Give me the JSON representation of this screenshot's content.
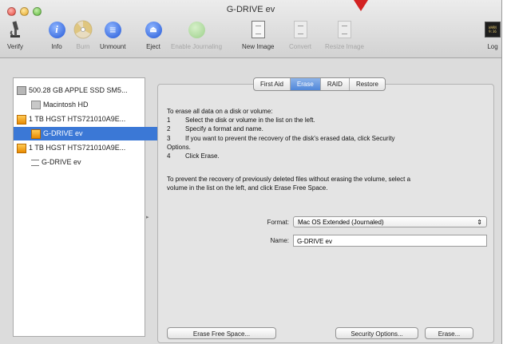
{
  "window": {
    "title": "G-DRIVE ev"
  },
  "toolbar": {
    "items": [
      {
        "label": "Verify",
        "icon": "microscope-icon",
        "enabled": true
      },
      {
        "label": "Info",
        "icon": "info-icon",
        "enabled": true
      },
      {
        "label": "Burn",
        "icon": "burn-disc-icon",
        "enabled": false
      },
      {
        "label": "Unmount",
        "icon": "unmount-icon",
        "enabled": true
      },
      {
        "label": "Eject",
        "icon": "eject-icon",
        "enabled": true
      },
      {
        "label": "Enable Journaling",
        "icon": "journaling-icon",
        "enabled": false
      },
      {
        "label": "New Image",
        "icon": "new-image-icon",
        "enabled": true
      },
      {
        "label": "Convert",
        "icon": "convert-icon",
        "enabled": false
      },
      {
        "label": "Resize Image",
        "icon": "resize-image-icon",
        "enabled": false
      },
      {
        "label": "Log",
        "icon": "log-icon",
        "enabled": true
      }
    ],
    "log_icon_text": "WARNIN\n9:36"
  },
  "sidebar": {
    "disks": [
      {
        "label": "500.28 GB APPLE SSD SM5...",
        "icon": "ssd-icon",
        "indent": 0,
        "selected": false
      },
      {
        "label": "Macintosh HD",
        "icon": "volume-icon",
        "indent": 1,
        "selected": false
      },
      {
        "label": "1 TB HGST HTS721010A9E...",
        "icon": "external-disk-icon",
        "indent": 0,
        "selected": false
      },
      {
        "label": "G-DRIVE ev",
        "icon": "external-volume-icon",
        "indent": 1,
        "selected": true
      },
      {
        "label": "1 TB HGST HTS721010A9E...",
        "icon": "external-disk-icon",
        "indent": 0,
        "selected": false
      },
      {
        "label": "G-DRIVE ev",
        "icon": "unmounted-volume-icon",
        "indent": 1,
        "selected": false
      }
    ]
  },
  "tabs": [
    {
      "label": "First Aid",
      "active": false
    },
    {
      "label": "Erase",
      "active": true
    },
    {
      "label": "RAID",
      "active": false
    },
    {
      "label": "Restore",
      "active": false
    }
  ],
  "erase": {
    "intro": "To erase all data on a disk or volume:",
    "steps": [
      {
        "num": "1",
        "text": "Select the disk or volume in the list on the left."
      },
      {
        "num": "2",
        "text": "Specify a format and name."
      },
      {
        "num": "3",
        "text": "If you want to prevent the recovery of the disk's erased data, click Security"
      },
      {
        "num": "",
        "text": "Options."
      },
      {
        "num": "4",
        "text": "Click Erase."
      }
    ],
    "free_space_note_1": "To prevent the recovery of previously deleted files without erasing the volume, select a",
    "free_space_note_2": "volume in the list on the left, and click Erase Free Space.",
    "format_label": "Format:",
    "format_value": "Mac OS Extended (Journaled)",
    "name_label": "Name:",
    "name_value": "G-DRIVE ev",
    "buttons": {
      "erase_free_space": "Erase Free Space...",
      "security_options": "Security Options...",
      "erase": "Erase..."
    }
  }
}
